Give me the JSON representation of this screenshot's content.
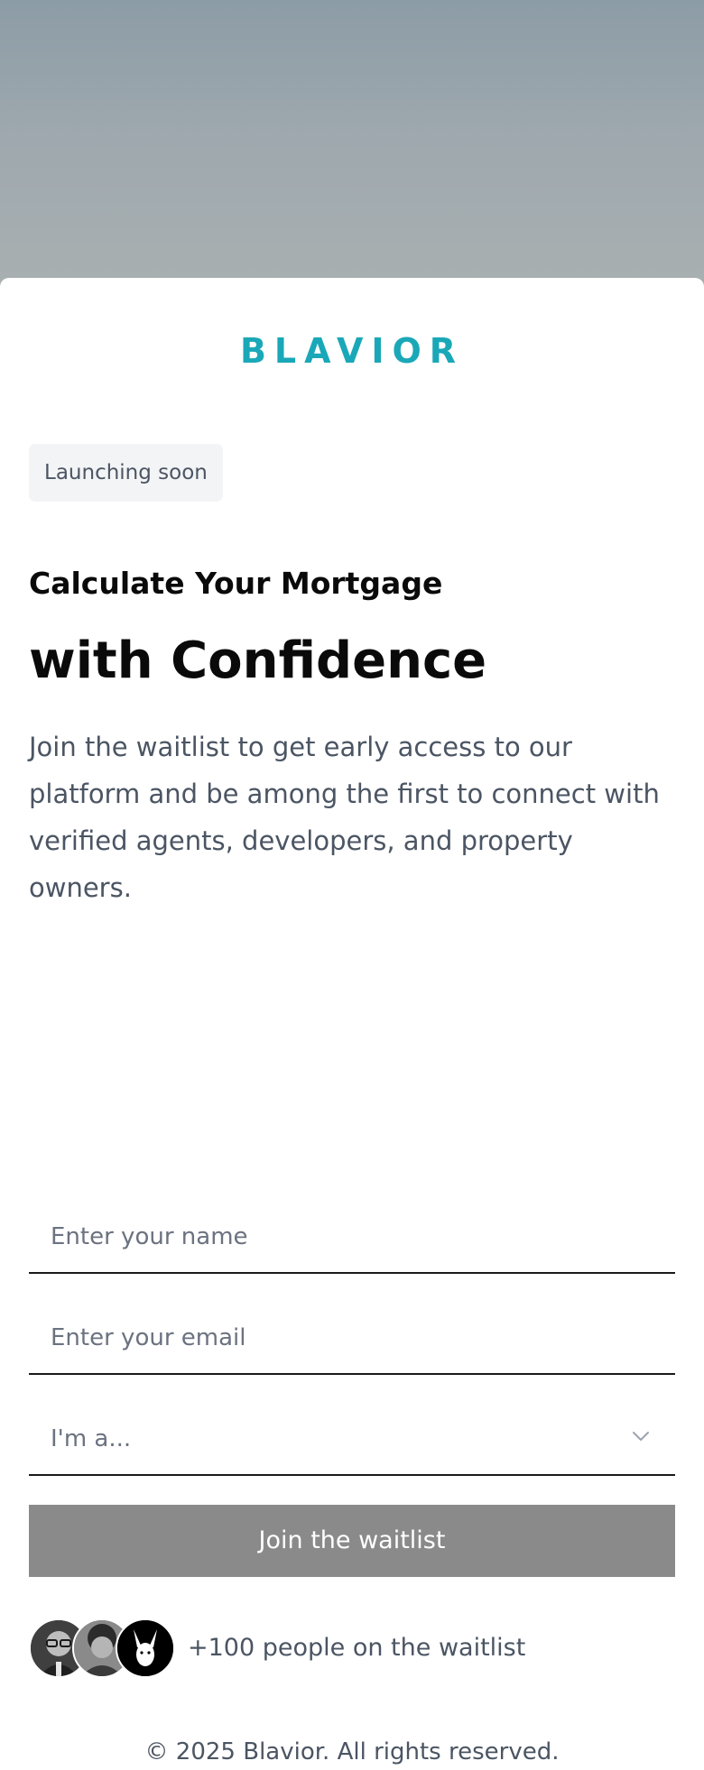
{
  "brand": {
    "logo_text": "BLAVIOR",
    "logo_color": "#1aa8b8"
  },
  "hero": {
    "badge": "Launching soon",
    "subtitle": "Calculate Your Mortgage",
    "title": "with Confidence",
    "description": "Join the waitlist to get early access to our platform and be among the first to connect with verified agents, developers, and property owners."
  },
  "form": {
    "name_placeholder": "Enter your name",
    "email_placeholder": "Enter your email",
    "role_placeholder": "I'm a...",
    "role_icon": "chevron-down-icon",
    "submit_label": "Join the waitlist",
    "submit_color": "#8a8a8a"
  },
  "social_proof": {
    "avatars": [
      "avatar-person-glasses",
      "avatar-person-curly-hair",
      "avatar-rabbit-logo"
    ],
    "text": "+100 people on the waitlist"
  },
  "footer": {
    "copyright": "© 2025 Blavior. All rights reserved."
  }
}
